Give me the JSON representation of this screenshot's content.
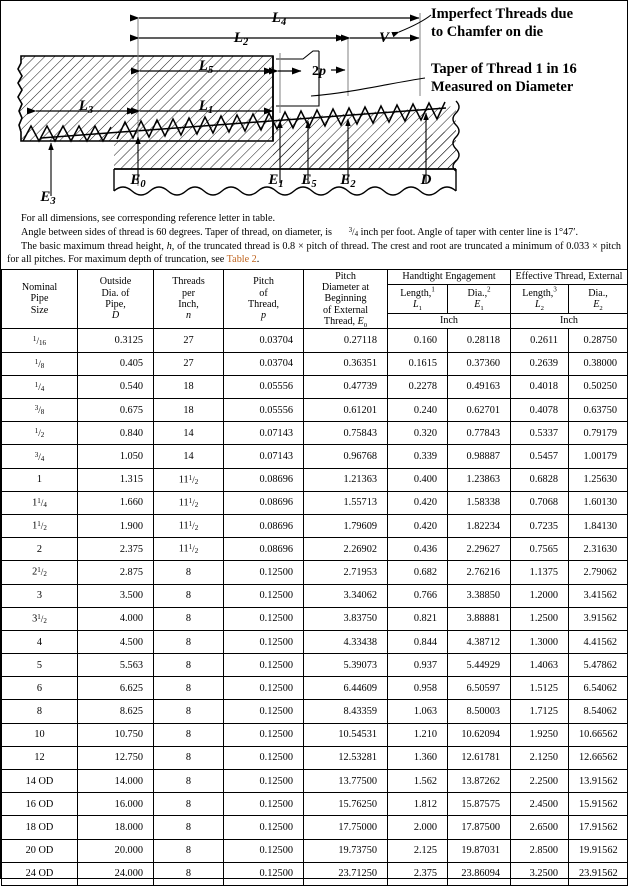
{
  "figure": {
    "labels": {
      "l4": "L4",
      "l2": "L2",
      "l5": "L5",
      "l1": "L1",
      "l3": "L3",
      "v": "V",
      "two_p": "2p",
      "e0": "E0",
      "e1": "E1",
      "e2": "E2",
      "e3": "E3",
      "e5": "E5",
      "d": "D"
    },
    "callouts": {
      "imperfect_line1": "Imperfect Threads due",
      "imperfect_line2": "to Chamfer on die",
      "taper_line1": "Taper of Thread 1 in 16",
      "taper_line2": "Measured on Diameter"
    }
  },
  "notes": {
    "note1": "For all dimensions, see  corresponding reference letter in table.",
    "note2_a": "Angle between sides of thread is 60 degrees. Taper of thread, on diameter, is ",
    "note2_frac": "3/4",
    "note2_b": " inch per foot. Angle of taper with center line is 1°47′.",
    "note3_a": "The basic maximum thread height, ",
    "note3_h": "h",
    "note3_b": ", of the truncated thread is 0.8 × pitch of thread. The crest and root are truncated a minimum of 0.033 × pitch for all pitches. For maximum depth of truncation, see ",
    "note3_link": "Table 2",
    "note3_end": "."
  },
  "table": {
    "group_headers": {
      "handtight": "Handtight Engagement",
      "effective": "Effective Thread, External"
    },
    "columns": {
      "nominal": [
        "Nominal",
        "Pipe",
        "Size"
      ],
      "outside": [
        "Outside",
        "Dia. of",
        "Pipe,",
        "D"
      ],
      "threads": [
        "Threads",
        "per",
        "Inch,",
        "n"
      ],
      "pitch": [
        "Pitch",
        "of",
        "Thread,",
        "p"
      ],
      "pitchdia": [
        "Pitch",
        "Diameter at",
        "Beginning",
        "of External",
        "Thread, E0"
      ],
      "length1": [
        "Length,",
        "1",
        "L1"
      ],
      "dia1": [
        "Dia.,",
        "2",
        "E1"
      ],
      "length2": [
        "Length,",
        "3",
        "L2"
      ],
      "dia2": [
        "Dia.,",
        "E2"
      ]
    },
    "unit_row": {
      "handtight_unit": "Inch",
      "effective_unit": "Inch"
    },
    "rows": [
      {
        "size": "1/16",
        "size_type": "frac",
        "num": "1",
        "den": "16",
        "D": "0.3125",
        "n": "27",
        "p": "0.03704",
        "E0": "0.27118",
        "L1": "0.160",
        "E1": "0.28118",
        "L2": "0.2611",
        "E2": "0.28750"
      },
      {
        "size": "1/8",
        "size_type": "frac",
        "num": "1",
        "den": "8",
        "D": "0.405",
        "n": "27",
        "p": "0.03704",
        "E0": "0.36351",
        "L1": "0.1615",
        "E1": "0.37360",
        "L2": "0.2639",
        "E2": "0.38000"
      },
      {
        "size": "1/4",
        "size_type": "frac",
        "num": "1",
        "den": "4",
        "D": "0.540",
        "n": "18",
        "p": "0.05556",
        "E0": "0.47739",
        "L1": "0.2278",
        "E1": "0.49163",
        "L2": "0.4018",
        "E2": "0.50250"
      },
      {
        "size": "3/8",
        "size_type": "frac",
        "num": "3",
        "den": "8",
        "D": "0.675",
        "n": "18",
        "p": "0.05556",
        "E0": "0.61201",
        "L1": "0.240",
        "E1": "0.62701",
        "L2": "0.4078",
        "E2": "0.63750"
      },
      {
        "size": "1/2",
        "size_type": "frac",
        "num": "1",
        "den": "2",
        "D": "0.840",
        "n": "14",
        "p": "0.07143",
        "E0": "0.75843",
        "L1": "0.320",
        "E1": "0.77843",
        "L2": "0.5337",
        "E2": "0.79179"
      },
      {
        "size": "3/4",
        "size_type": "frac",
        "num": "3",
        "den": "4",
        "D": "1.050",
        "n": "14",
        "p": "0.07143",
        "E0": "0.96768",
        "L1": "0.339",
        "E1": "0.98887",
        "L2": "0.5457",
        "E2": "1.00179"
      },
      {
        "size": "1",
        "size_type": "plain",
        "D": "1.315",
        "n": "11 1/2",
        "n_type": "mixed",
        "n_whole": "11",
        "n_num": "1",
        "n_den": "2",
        "p": "0.08696",
        "E0": "1.21363",
        "L1": "0.400",
        "E1": "1.23863",
        "L2": "0.6828",
        "E2": "1.25630"
      },
      {
        "size": "1 1/4",
        "size_type": "mixed",
        "whole": "1",
        "num": "1",
        "den": "4",
        "D": "1.660",
        "n": "11 1/2",
        "n_type": "mixed",
        "n_whole": "11",
        "n_num": "1",
        "n_den": "2",
        "p": "0.08696",
        "E0": "1.55713",
        "L1": "0.420",
        "E1": "1.58338",
        "L2": "0.7068",
        "E2": "1.60130"
      },
      {
        "size": "1 1/2",
        "size_type": "mixed",
        "whole": "1",
        "num": "1",
        "den": "2",
        "D": "1.900",
        "n": "11 1/2",
        "n_type": "mixed",
        "n_whole": "11",
        "n_num": "1",
        "n_den": "2",
        "p": "0.08696",
        "E0": "1.79609",
        "L1": "0.420",
        "E1": "1.82234",
        "L2": "0.7235",
        "E2": "1.84130"
      },
      {
        "size": "2",
        "size_type": "plain",
        "D": "2.375",
        "n": "11 1/2",
        "n_type": "mixed",
        "n_whole": "11",
        "n_num": "1",
        "n_den": "2",
        "p": "0.08696",
        "E0": "2.26902",
        "L1": "0.436",
        "E1": "2.29627",
        "L2": "0.7565",
        "E2": "2.31630"
      },
      {
        "size": "2 1/2",
        "size_type": "mixed",
        "whole": "2",
        "num": "1",
        "den": "2",
        "D": "2.875",
        "n": "8",
        "n_type": "plain",
        "p": "0.12500",
        "E0": "2.71953",
        "L1": "0.682",
        "E1": "2.76216",
        "L2": "1.1375",
        "E2": "2.79062"
      },
      {
        "size": "3",
        "size_type": "plain",
        "D": "3.500",
        "n": "8",
        "n_type": "plain",
        "p": "0.12500",
        "E0": "3.34062",
        "L1": "0.766",
        "E1": "3.38850",
        "L2": "1.2000",
        "E2": "3.41562"
      },
      {
        "size": "3 1/2",
        "size_type": "mixed",
        "whole": "3",
        "num": "1",
        "den": "2",
        "D": "4.000",
        "n": "8",
        "n_type": "plain",
        "p": "0.12500",
        "E0": "3.83750",
        "L1": "0.821",
        "E1": "3.88881",
        "L2": "1.2500",
        "E2": "3.91562"
      },
      {
        "size": "4",
        "size_type": "plain",
        "D": "4.500",
        "n": "8",
        "n_type": "plain",
        "p": "0.12500",
        "E0": "4.33438",
        "L1": "0.844",
        "E1": "4.38712",
        "L2": "1.3000",
        "E2": "4.41562"
      },
      {
        "size": "5",
        "size_type": "plain",
        "D": "5.563",
        "n": "8",
        "n_type": "plain",
        "p": "0.12500",
        "E0": "5.39073",
        "L1": "0.937",
        "E1": "5.44929",
        "L2": "1.4063",
        "E2": "5.47862"
      },
      {
        "size": "6",
        "size_type": "plain",
        "D": "6.625",
        "n": "8",
        "n_type": "plain",
        "p": "0.12500",
        "E0": "6.44609",
        "L1": "0.958",
        "E1": "6.50597",
        "L2": "1.5125",
        "E2": "6.54062"
      },
      {
        "size": "8",
        "size_type": "plain",
        "D": "8.625",
        "n": "8",
        "n_type": "plain",
        "p": "0.12500",
        "E0": "8.43359",
        "L1": "1.063",
        "E1": "8.50003",
        "L2": "1.7125",
        "E2": "8.54062"
      },
      {
        "size": "10",
        "size_type": "plain",
        "D": "10.750",
        "n": "8",
        "n_type": "plain",
        "p": "0.12500",
        "E0": "10.54531",
        "L1": "1.210",
        "E1": "10.62094",
        "L2": "1.9250",
        "E2": "10.66562"
      },
      {
        "size": "12",
        "size_type": "plain",
        "D": "12.750",
        "n": "8",
        "n_type": "plain",
        "p": "0.12500",
        "E0": "12.53281",
        "L1": "1.360",
        "E1": "12.61781",
        "L2": "2.1250",
        "E2": "12.66562"
      },
      {
        "size": "14 OD",
        "size_type": "plain",
        "D": "14.000",
        "n": "8",
        "n_type": "plain",
        "p": "0.12500",
        "E0": "13.77500",
        "L1": "1.562",
        "E1": "13.87262",
        "L2": "2.2500",
        "E2": "13.91562"
      },
      {
        "size": "16 OD",
        "size_type": "plain",
        "D": "16.000",
        "n": "8",
        "n_type": "plain",
        "p": "0.12500",
        "E0": "15.76250",
        "L1": "1.812",
        "E1": "15.87575",
        "L2": "2.4500",
        "E2": "15.91562"
      },
      {
        "size": "18 OD",
        "size_type": "plain",
        "D": "18.000",
        "n": "8",
        "n_type": "plain",
        "p": "0.12500",
        "E0": "17.75000",
        "L1": "2.000",
        "E1": "17.87500",
        "L2": "2.6500",
        "E2": "17.91562"
      },
      {
        "size": "20 OD",
        "size_type": "plain",
        "D": "20.000",
        "n": "8",
        "n_type": "plain",
        "p": "0.12500",
        "E0": "19.73750",
        "L1": "2.125",
        "E1": "19.87031",
        "L2": "2.8500",
        "E2": "19.91562"
      },
      {
        "size": "24 OD",
        "size_type": "plain",
        "D": "24.000",
        "n": "8",
        "n_type": "plain",
        "p": "0.12500",
        "E0": "23.71250",
        "L1": "2.375",
        "E1": "23.86094",
        "L2": "3.2500",
        "E2": "23.91562"
      }
    ]
  },
  "colors": {
    "link": "#C0651F",
    "ink": "#000000",
    "paper": "#FFFFFF"
  }
}
